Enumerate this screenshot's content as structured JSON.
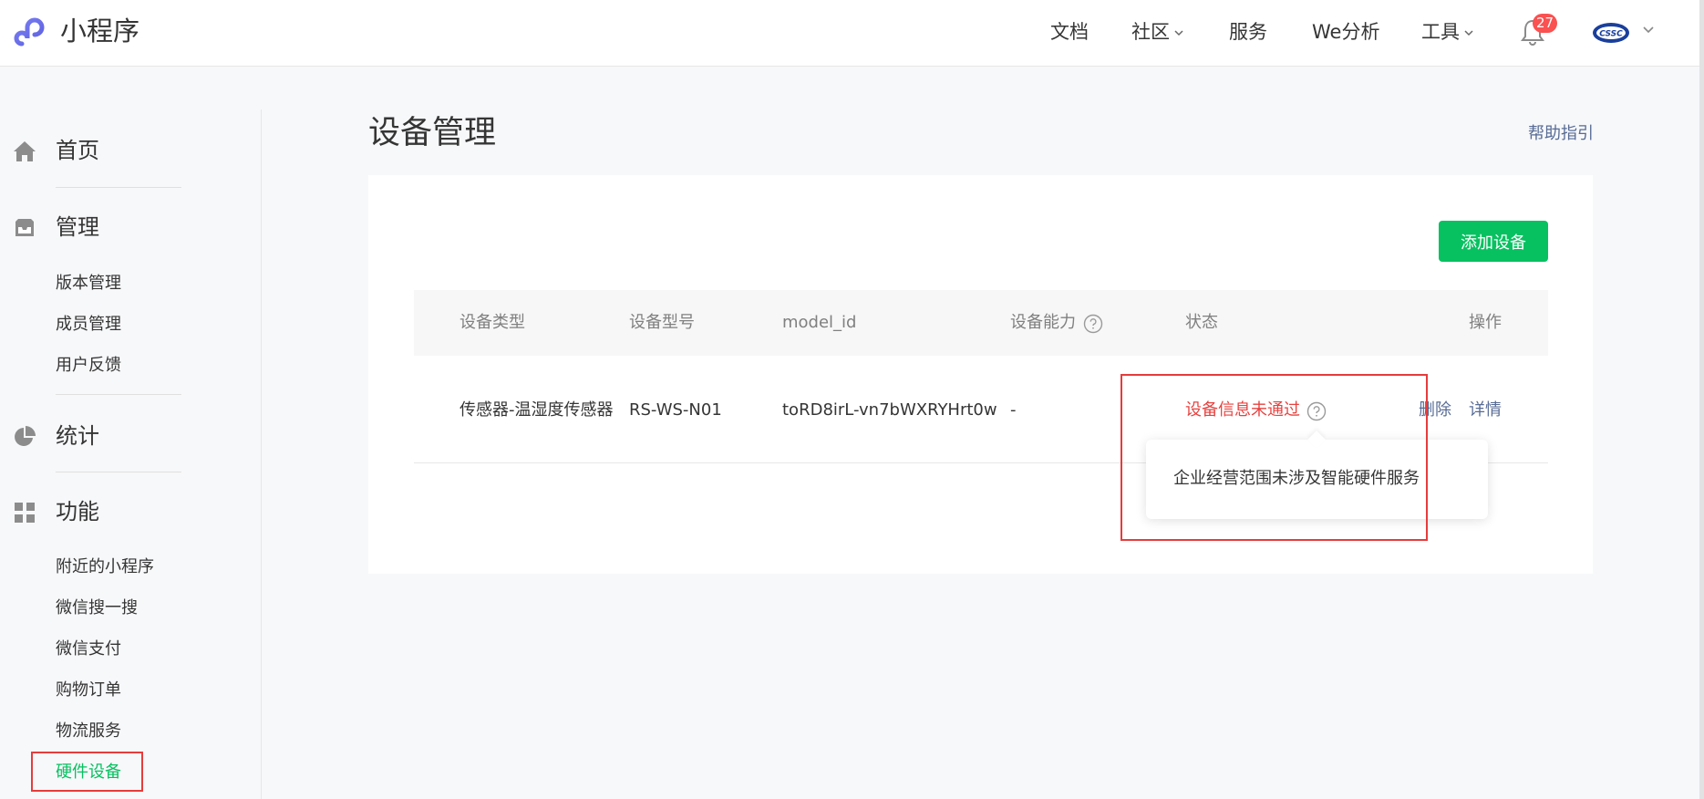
{
  "header": {
    "brand": "小程序",
    "nav": [
      {
        "label": "文档",
        "has_dropdown": false
      },
      {
        "label": "社区",
        "has_dropdown": true
      },
      {
        "label": "服务",
        "has_dropdown": false
      },
      {
        "label": "We分析",
        "has_dropdown": false
      },
      {
        "label": "工具",
        "has_dropdown": true
      }
    ],
    "notifications_count": "27",
    "avatar_text": "CSSC"
  },
  "sidebar": {
    "sections": [
      {
        "label": "首页",
        "icon": "home-icon",
        "items": []
      },
      {
        "label": "管理",
        "icon": "inbox-icon",
        "items": [
          "版本管理",
          "成员管理",
          "用户反馈"
        ]
      },
      {
        "label": "统计",
        "icon": "pie-chart-icon",
        "items": []
      },
      {
        "label": "功能",
        "icon": "grid-icon",
        "items": [
          "附近的小程序",
          "微信搜一搜",
          "微信支付",
          "购物订单",
          "物流服务",
          "硬件设备"
        ]
      }
    ],
    "active_item": "硬件设备"
  },
  "main": {
    "title": "设备管理",
    "help_link": "帮助指引",
    "add_button": "添加设备",
    "table": {
      "headers": [
        "设备类型",
        "设备型号",
        "model_id",
        "设备能力",
        "状态",
        "操作"
      ],
      "rows": [
        {
          "type": "传感器-温湿度传感器",
          "model": "RS-WS-N01",
          "model_id": "toRD8irL-vn7bWXRYHrt0w",
          "capability": "-",
          "status": "设备信息未通过",
          "actions": [
            "删除",
            "详情"
          ]
        }
      ]
    },
    "tooltip": "企业经营范围未涉及智能硬件服务"
  },
  "colors": {
    "accent": "#07c160",
    "link": "#576b95",
    "error": "#e64340",
    "badge": "#fa5151",
    "annotation": "#e63c3c"
  }
}
